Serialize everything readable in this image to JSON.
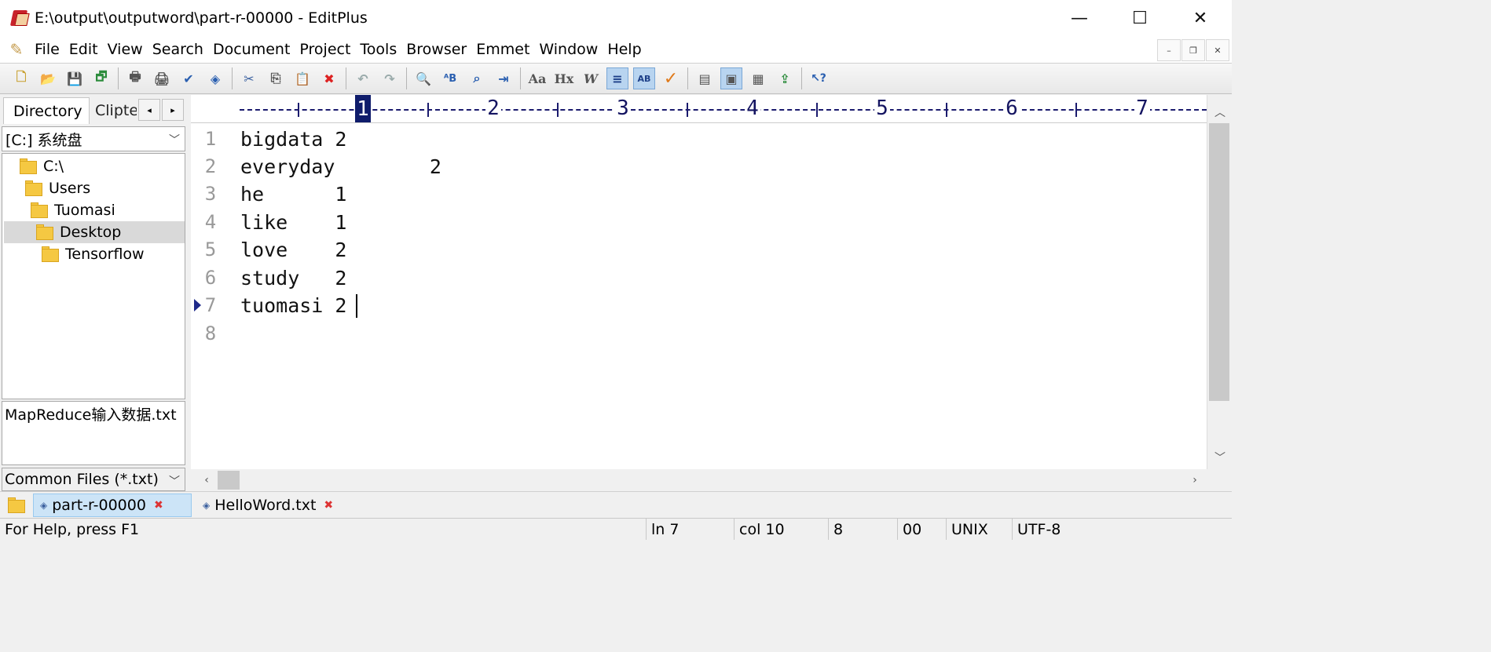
{
  "window": {
    "title": "E:\\output\\outputword\\part-r-00000 - EditPlus",
    "minimize_glyph": "—",
    "maximize_glyph": "☐",
    "close_glyph": "✕"
  },
  "menu": {
    "items": [
      "File",
      "Edit",
      "View",
      "Search",
      "Document",
      "Project",
      "Tools",
      "Browser",
      "Emmet",
      "Window",
      "Help"
    ],
    "mdi_minimize": "–",
    "mdi_restore": "❐",
    "mdi_close": "✕"
  },
  "toolbar": {
    "buttons": [
      {
        "name": "new-file",
        "glyph": "🗋"
      },
      {
        "name": "open-file",
        "glyph": "📂"
      },
      {
        "name": "save",
        "glyph": "💾"
      },
      {
        "name": "save-all",
        "glyph": "🗗"
      },
      {
        "name": "print-preview",
        "glyph": "🖶"
      },
      {
        "name": "print",
        "glyph": "🖨"
      },
      {
        "name": "spell-check",
        "glyph": "✔"
      },
      {
        "name": "browser-preview",
        "glyph": "◈"
      },
      {
        "name": "cut",
        "glyph": "✂"
      },
      {
        "name": "copy",
        "glyph": "⎘"
      },
      {
        "name": "paste",
        "glyph": "📋"
      },
      {
        "name": "delete",
        "glyph": "✖"
      },
      {
        "name": "undo",
        "glyph": "↶"
      },
      {
        "name": "redo",
        "glyph": "↷"
      },
      {
        "name": "find",
        "glyph": "🔍"
      },
      {
        "name": "replace",
        "glyph": "ᴬB"
      },
      {
        "name": "find-in-files",
        "glyph": "⌕"
      },
      {
        "name": "goto-line",
        "glyph": "⇥"
      },
      {
        "name": "font",
        "glyph": "Aa"
      },
      {
        "name": "html-toolbar",
        "glyph": "Hx"
      },
      {
        "name": "word-wrap",
        "glyph": "W"
      },
      {
        "name": "line-numbers",
        "glyph": "≡"
      },
      {
        "name": "column-select",
        "glyph": "AB"
      },
      {
        "name": "check-mark",
        "glyph": "✓"
      },
      {
        "name": "directory-window",
        "glyph": "▤"
      },
      {
        "name": "output-window",
        "glyph": "▣"
      },
      {
        "name": "cliptext-window",
        "glyph": "▦"
      },
      {
        "name": "ftp-window",
        "glyph": "⇪"
      },
      {
        "name": "context-help",
        "glyph": "↖?"
      }
    ]
  },
  "left_panel": {
    "tabs": [
      "Directory",
      "Clipte"
    ],
    "scroll_left": "◂",
    "scroll_right": "▸",
    "drive": "[C:] 系统盘",
    "dropdown_glyph": "﹀",
    "tree": [
      {
        "label": "C:\\",
        "indent": 0
      },
      {
        "label": "Users",
        "indent": 1
      },
      {
        "label": "Tuomasi",
        "indent": 2
      },
      {
        "label": "Desktop",
        "indent": 3,
        "selected": true
      },
      {
        "label": "Tensorflow",
        "indent": 4
      }
    ],
    "files": [
      "MapReduce输入数据.txt"
    ],
    "filter": "Common Files (*.txt)"
  },
  "ruler": {
    "numbers": [
      "1",
      "2",
      "3",
      "4",
      "5",
      "6",
      "7"
    ],
    "current_column": "1"
  },
  "editor": {
    "lines": [
      {
        "num": "1",
        "text": "bigdata 2"
      },
      {
        "num": "2",
        "text": "everyday\t2"
      },
      {
        "num": "3",
        "text": "he\t1"
      },
      {
        "num": "4",
        "text": "like\t1"
      },
      {
        "num": "5",
        "text": "love\t2"
      },
      {
        "num": "6",
        "text": "study\t2"
      },
      {
        "num": "7",
        "text": "tuomasi 2"
      },
      {
        "num": "8",
        "text": ""
      }
    ],
    "current_line": 7
  },
  "scrollbars": {
    "up": "︿",
    "down": "﹀",
    "left": "‹",
    "right": "›"
  },
  "doc_tabs": [
    {
      "label": "part-r-00000",
      "active": true
    },
    {
      "label": "HelloWord.txt",
      "active": false
    }
  ],
  "doc_tab_close_glyph": "✖",
  "doc_tab_modified_glyph": "◈",
  "status": {
    "help": "For Help, press F1",
    "line": "ln 7",
    "col": "col 10",
    "num1": "8",
    "num2": "00",
    "eol": "UNIX",
    "encoding": "UTF-8"
  }
}
